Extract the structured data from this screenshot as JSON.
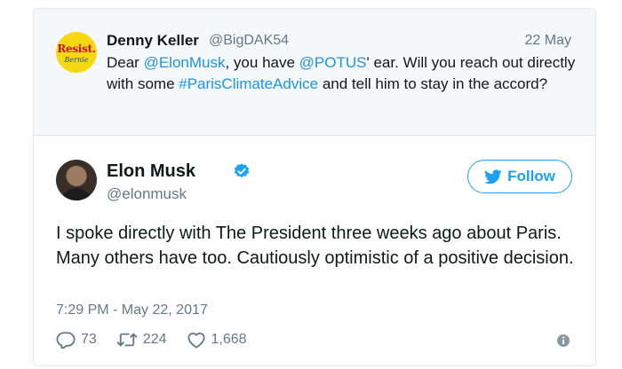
{
  "parent_tweet": {
    "avatar_text_top": "Resist.",
    "avatar_text_bottom": "Bernie",
    "display_name": "Denny Keller",
    "handle": "@BigDAK54",
    "date": "22 May",
    "text_parts": {
      "p1": "Dear ",
      "mention1": "@ElonMusk",
      "p2": ", you have ",
      "mention2": "@POTUS",
      "p3": "' ear. Will you reach out directly with some ",
      "hashtag": "#ParisClimateAdvice",
      "p4": " and tell him to stay in the accord?"
    }
  },
  "tweet": {
    "display_name": "Elon Musk",
    "handle": "@elonmusk",
    "verified_icon": "verified-badge-icon",
    "follow_label": "Follow",
    "text": "I spoke directly with The President three weeks ago about Paris. Many others have too. Cautiously optimistic of a positive decision.",
    "timestamp": "7:29 PM - May 22, 2017",
    "replies": "73",
    "retweets": "224",
    "likes": "1,668"
  },
  "colors": {
    "link": "#1b95e0",
    "brand": "#1da1f2",
    "muted": "#657786",
    "parent_bg": "#f5f8fa"
  }
}
